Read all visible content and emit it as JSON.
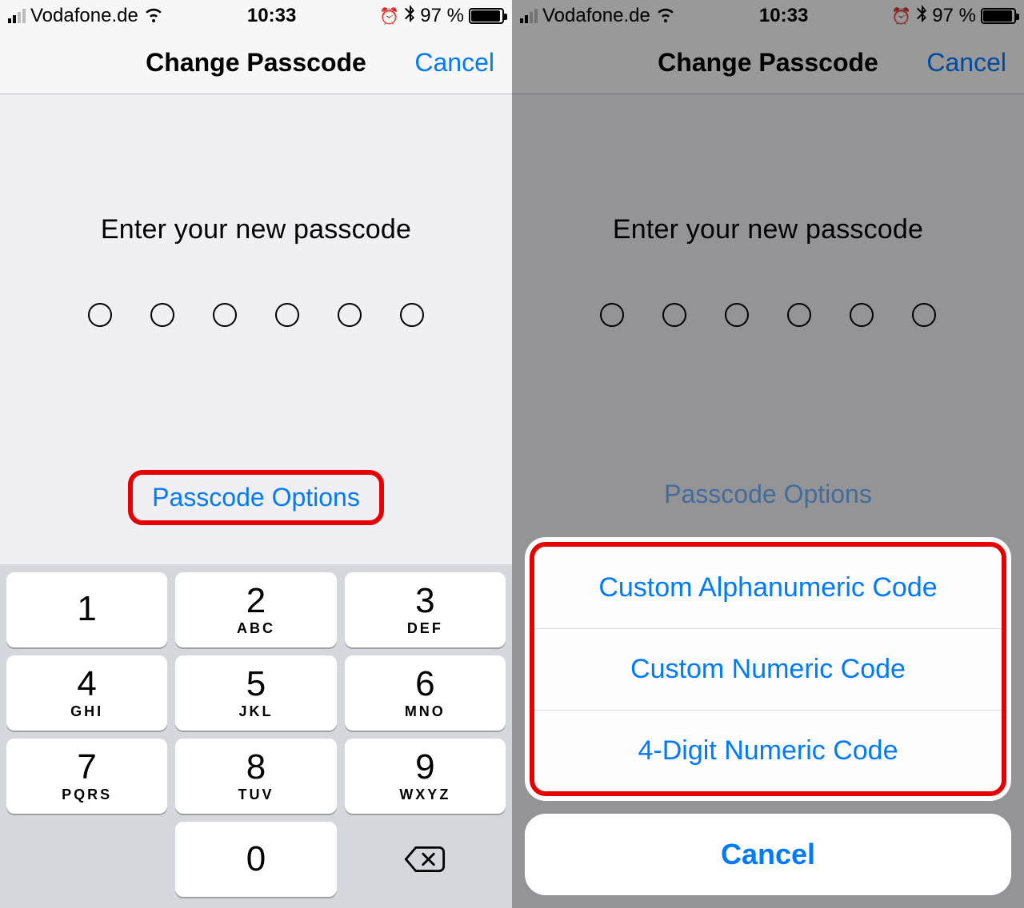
{
  "status": {
    "carrier": "Vodafone.de",
    "time": "10:33",
    "battery_pct": "97 %"
  },
  "nav": {
    "title": "Change Passcode",
    "cancel": "Cancel"
  },
  "prompt": {
    "text": "Enter your new passcode",
    "options_label": "Passcode Options"
  },
  "keypad": {
    "keys": [
      {
        "num": "1",
        "letters": ""
      },
      {
        "num": "2",
        "letters": "ABC"
      },
      {
        "num": "3",
        "letters": "DEF"
      },
      {
        "num": "4",
        "letters": "GHI"
      },
      {
        "num": "5",
        "letters": "JKL"
      },
      {
        "num": "6",
        "letters": "MNO"
      },
      {
        "num": "7",
        "letters": "PQRS"
      },
      {
        "num": "8",
        "letters": "TUV"
      },
      {
        "num": "9",
        "letters": "WXYZ"
      },
      {
        "num": "0",
        "letters": ""
      }
    ]
  },
  "sheet": {
    "items": [
      "Custom Alphanumeric Code",
      "Custom Numeric Code",
      "4-Digit Numeric Code"
    ],
    "cancel": "Cancel"
  }
}
